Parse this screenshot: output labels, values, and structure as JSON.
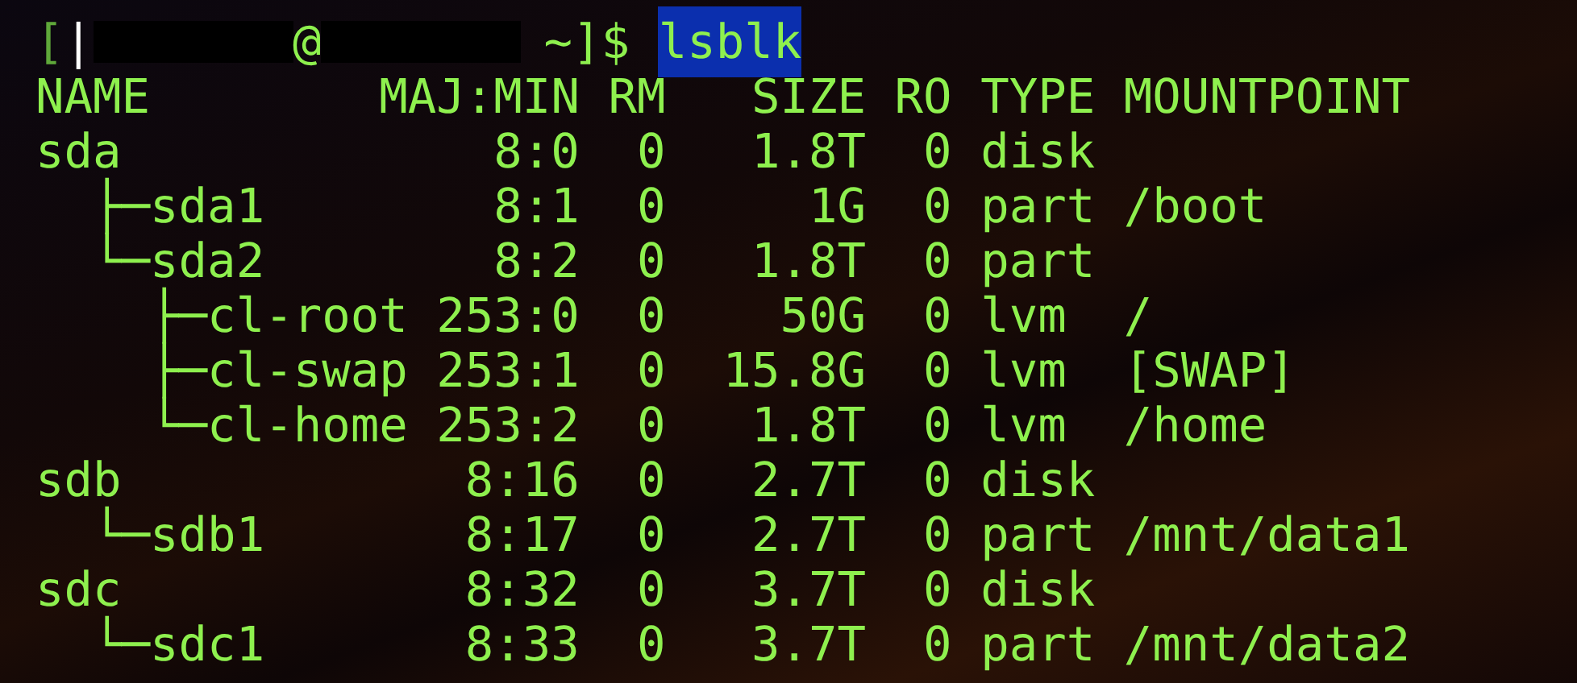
{
  "prompt": {
    "open": "[",
    "mark": "|",
    "at": "@",
    "suffix": "~]$",
    "command": "lsblk"
  },
  "columns": [
    "NAME",
    "MAJ:MIN",
    "RM",
    "SIZE",
    "RO",
    "TYPE",
    "MOUNTPOINT"
  ],
  "devices": [
    {
      "name": "sda",
      "majmin": "8:0",
      "rm": "0",
      "size": "1.8T",
      "ro": "0",
      "type": "disk",
      "children": [
        {
          "name": "├─sda1",
          "majmin": "8:1",
          "rm": "0",
          "size": "1G",
          "ro": "0",
          "type": "part",
          "mountpoint": "/boot"
        },
        {
          "name": "└─sda2",
          "majmin": "8:2",
          "rm": "0",
          "size": "1.8T",
          "ro": "0",
          "type": "part",
          "children": [
            {
              "name": "├─cl-root",
              "majmin": "253:0",
              "rm": "0",
              "size": "50G",
              "ro": "0",
              "type": "lvm",
              "mountpoint": "/"
            },
            {
              "name": "├─cl-swap",
              "majmin": "253:1",
              "rm": "0",
              "size": "15.8G",
              "ro": "0",
              "type": "lvm",
              "mountpoint": "[SWAP]"
            },
            {
              "name": "└─cl-home",
              "majmin": "253:2",
              "rm": "0",
              "size": "1.8T",
              "ro": "0",
              "type": "lvm",
              "mountpoint": "/home"
            }
          ]
        }
      ]
    },
    {
      "name": "sdb",
      "majmin": "8:16",
      "rm": "0",
      "size": "2.7T",
      "ro": "0",
      "type": "disk",
      "children": [
        {
          "name": "└─sdb1",
          "majmin": "8:17",
          "rm": "0",
          "size": "2.7T",
          "ro": "0",
          "type": "part",
          "mountpoint": "/mnt/data1"
        }
      ]
    },
    {
      "name": "sdc",
      "majmin": "8:32",
      "rm": "0",
      "size": "3.7T",
      "ro": "0",
      "type": "disk",
      "children": [
        {
          "name": "└─sdc1",
          "majmin": "8:33",
          "rm": "0",
          "size": "3.7T",
          "ro": "0",
          "type": "part",
          "mountpoint": "/mnt/data2"
        }
      ]
    }
  ]
}
